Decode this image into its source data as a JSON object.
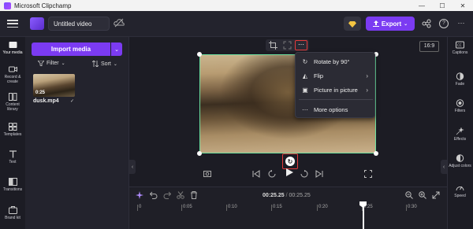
{
  "window": {
    "title": "Microsoft Clipchamp",
    "minimize": "—",
    "maximize": "☐",
    "close": "✕"
  },
  "topbar": {
    "project_name": "Untitled video",
    "export_label": "Export"
  },
  "left_nav": [
    {
      "label": "Your media",
      "icon": "media-icon"
    },
    {
      "label": "Record & create",
      "icon": "record-icon"
    },
    {
      "label": "Content library",
      "icon": "library-icon"
    },
    {
      "label": "Templates",
      "icon": "templates-icon"
    },
    {
      "label": "Text",
      "icon": "text-icon"
    },
    {
      "label": "Transitions",
      "icon": "transitions-icon"
    },
    {
      "label": "Brand kit",
      "icon": "brand-kit-icon"
    }
  ],
  "media_panel": {
    "import_label": "Import media",
    "filter_label": "Filter",
    "sort_label": "Sort",
    "items": [
      {
        "name": "dusk.mp4",
        "duration": "0:25"
      }
    ]
  },
  "preview": {
    "aspect_ratio": "16:9"
  },
  "context_menu": {
    "items": [
      {
        "label": "Rotate by 90°",
        "icon": "rotate-icon",
        "has_submenu": false
      },
      {
        "label": "Flip",
        "icon": "flip-icon",
        "has_submenu": true
      },
      {
        "label": "Picture in picture",
        "icon": "pip-icon",
        "has_submenu": true
      },
      {
        "label": "More options",
        "icon": "more-options-icon",
        "has_submenu": false
      }
    ]
  },
  "timeline": {
    "current_time": "00:25.25",
    "separator": "/",
    "total_time": "00:25.25",
    "ruler": [
      "0",
      "0:05",
      "0:10",
      "0:15",
      "0:20",
      "0:25",
      "0:30"
    ]
  },
  "right_nav": [
    {
      "label": "Captions",
      "icon": "captions-icon"
    },
    {
      "label": "Fade",
      "icon": "fade-icon"
    },
    {
      "label": "Filters",
      "icon": "filters-icon"
    },
    {
      "label": "Effects",
      "icon": "effects-icon"
    },
    {
      "label": "Adjust colors",
      "icon": "adjust-colors-icon"
    },
    {
      "label": "Speed",
      "icon": "speed-icon"
    }
  ],
  "colors": {
    "accent": "#7b3bf2",
    "highlight": "#e53b3b",
    "selection": "#6be0a0"
  }
}
